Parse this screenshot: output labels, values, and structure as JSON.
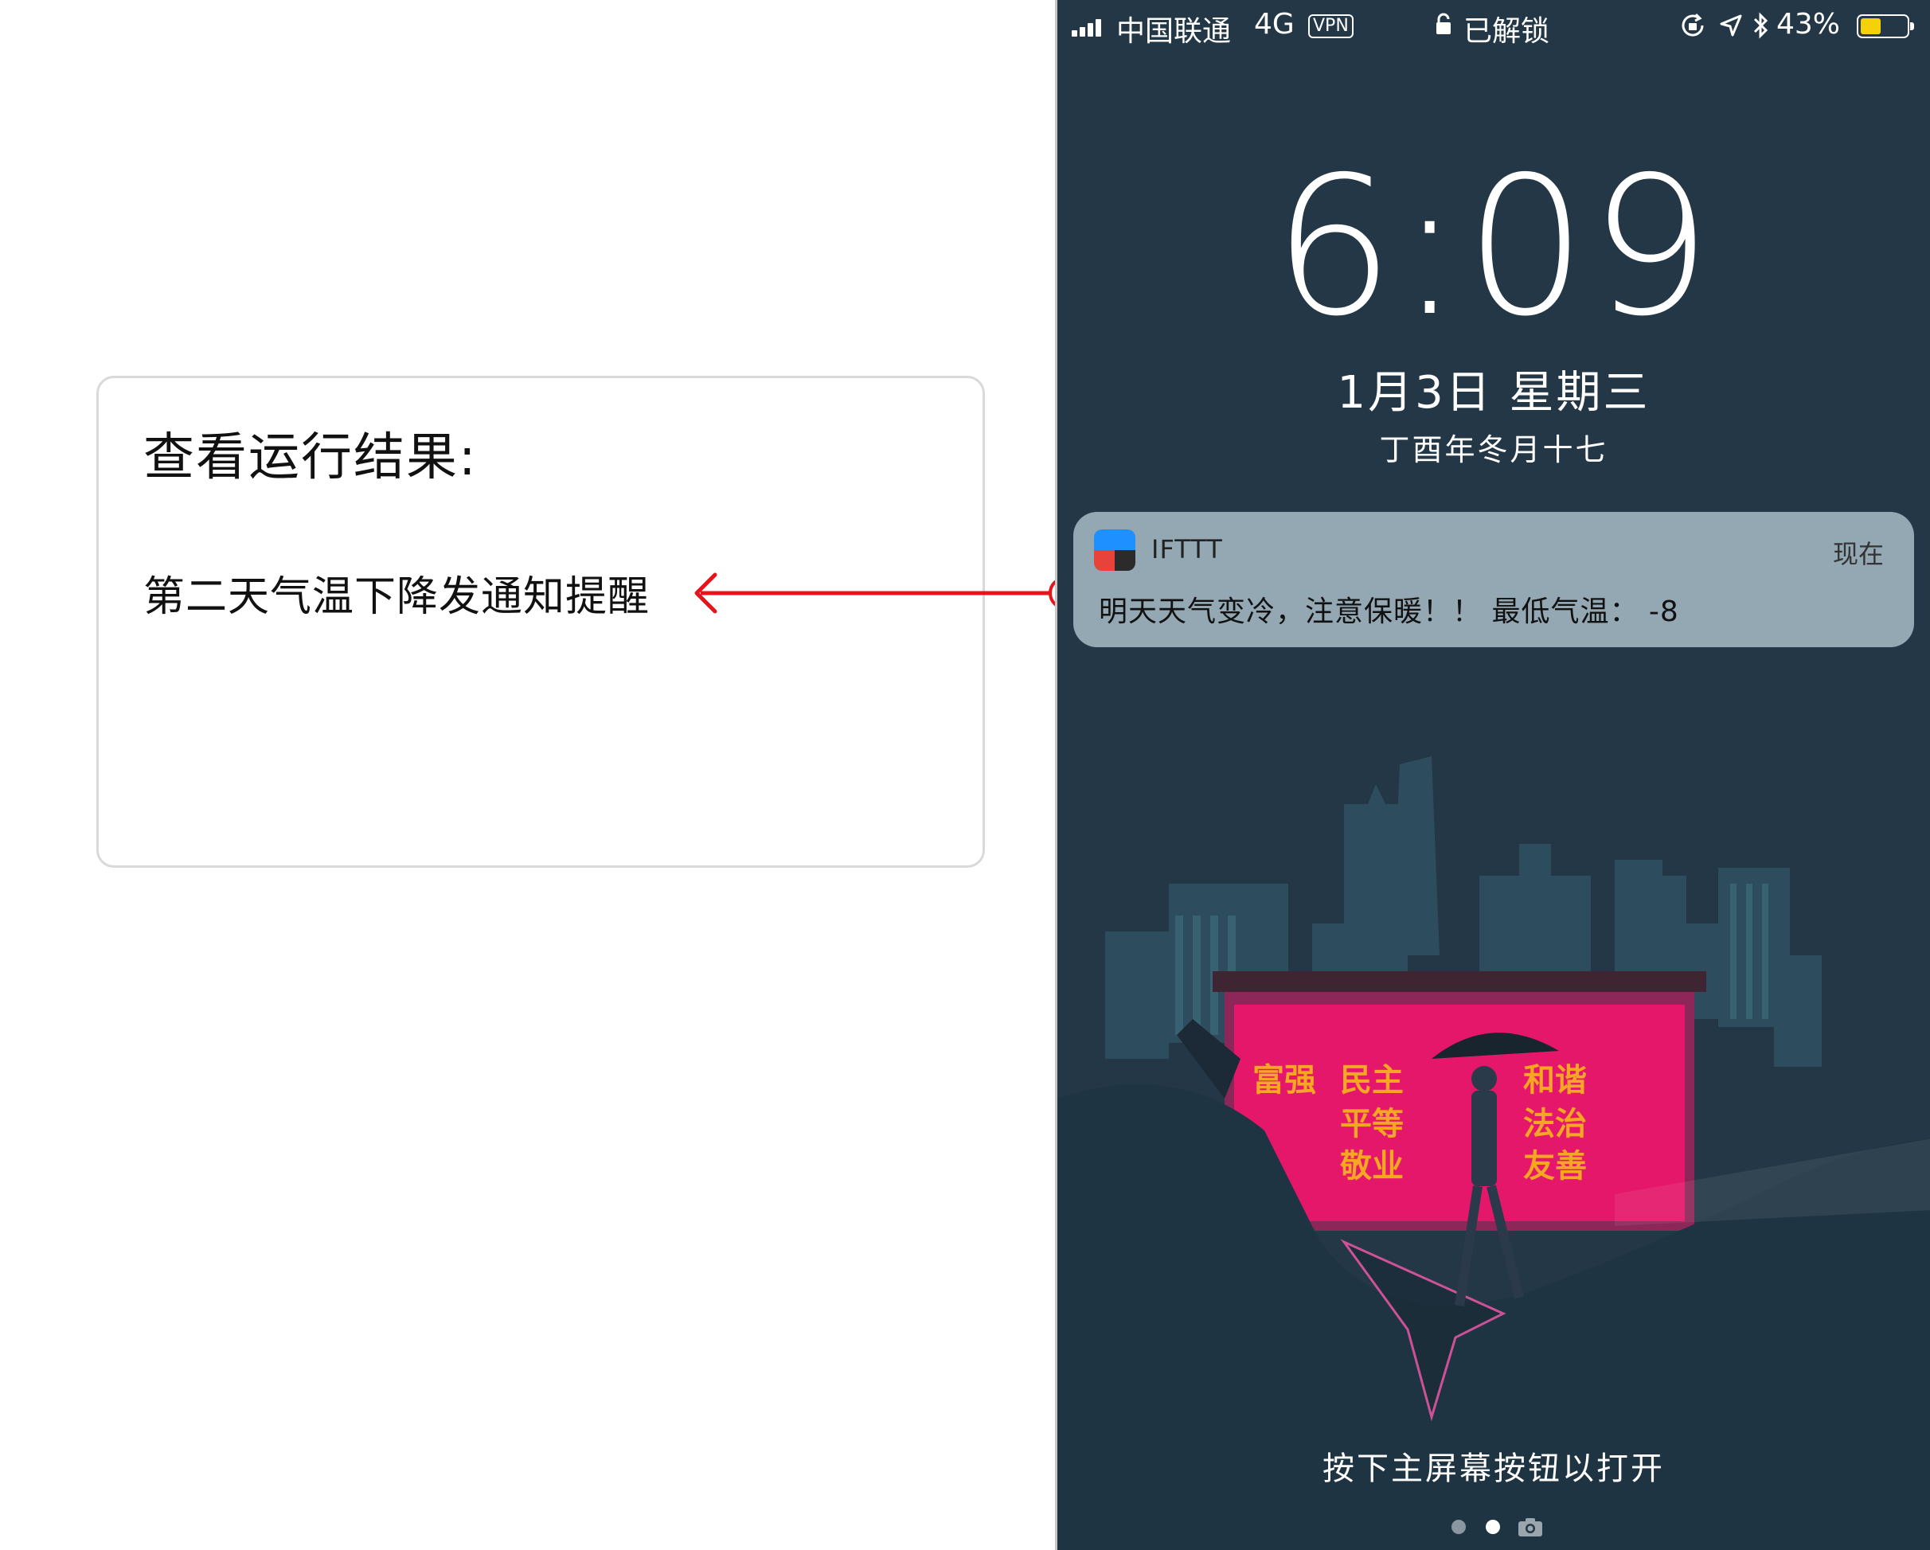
{
  "annotation": {
    "title": "查看运行结果:",
    "result": "第二天气温下降发通知提醒"
  },
  "status_bar": {
    "carrier": "中国联通",
    "network": "4G",
    "vpn": "VPN",
    "lock_status": "已解锁",
    "battery": "43%",
    "battery_level": 0.43
  },
  "lock_screen": {
    "time": "6:09",
    "date": "1月3日 星期三",
    "lunar_date": "丁酉年冬月十七",
    "hint": "按下主屏幕按钮以打开"
  },
  "notification": {
    "app_name": "IFTTT",
    "time": "现在",
    "message": "明天天气变冷，注意保暖！！  最低气温：  -8"
  },
  "wallpaper_slogans": [
    "富强",
    "民主",
    "和谐",
    "平等",
    "法治",
    "敬业",
    "友善"
  ],
  "colors": {
    "lock_background": "#233746",
    "arrow": "#e8141c",
    "billboard": "#e5176a",
    "battery_fill": "#f5d10a"
  }
}
